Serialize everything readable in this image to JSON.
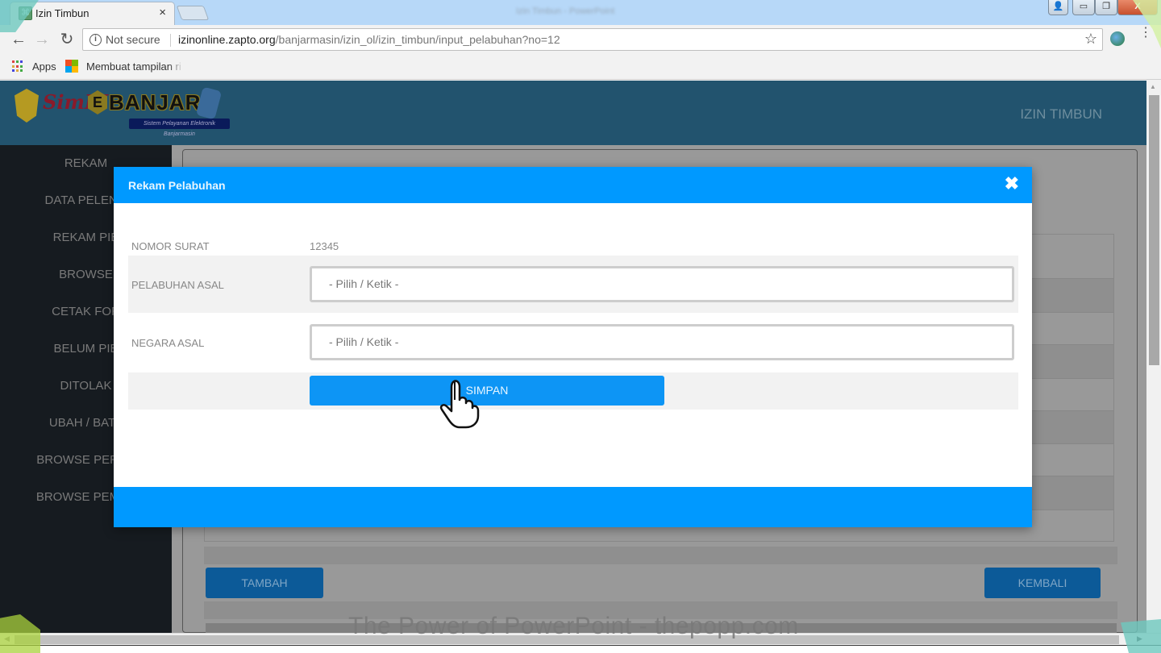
{
  "browser": {
    "tab_title": "Izin Timbun",
    "tab_close": "×",
    "window_title": "Izin Timbun - PowerPoint",
    "security_label": "Not secure",
    "url_host": "izinonline.zapto.org",
    "url_path": "/banjarmasin/izin_ol/izin_timbun/input_pelabuhan?no=12",
    "bookmarks": [
      {
        "label": "Apps"
      },
      {
        "label": "Membuat tampilan ri"
      }
    ]
  },
  "app": {
    "logo_text_sim": "SimPI",
    "logo_text_e": "E",
    "logo_text_banjar": "BANJAR",
    "logo_tagline": "Sistem Pelayanan Elektronik Banjarmasin",
    "header_title": "IZIN TIMBUN",
    "sidebar": [
      {
        "label": "REKAM"
      },
      {
        "label": "DATA PELENG"
      },
      {
        "label": "REKAM PIB"
      },
      {
        "label": "BROWSE"
      },
      {
        "label": "CETAK FOR"
      },
      {
        "label": "BELUM PIB"
      },
      {
        "label": "DITOLAK"
      },
      {
        "label": "UBAH / BATA"
      },
      {
        "label": "BROWSE PERUB"
      },
      {
        "label": "BROWSE PEMBA"
      }
    ],
    "background_buttons": {
      "add": "TAMBAH",
      "back": "KEMBALI"
    }
  },
  "modal": {
    "title": "Rekam Pelabuhan",
    "close_icon": "✖",
    "fields": [
      {
        "label": "NOMOR SURAT",
        "value": "12345"
      },
      {
        "label": "PELABUHAN ASAL",
        "placeholder": "- Pilih / Ketik -",
        "value": ""
      },
      {
        "label": "NEGARA ASAL",
        "placeholder": "- Pilih / Ketik -",
        "value": ""
      }
    ],
    "submit_label": "SIMPAN"
  },
  "watermark": "The Power of PowerPoint - thepopp.com"
}
